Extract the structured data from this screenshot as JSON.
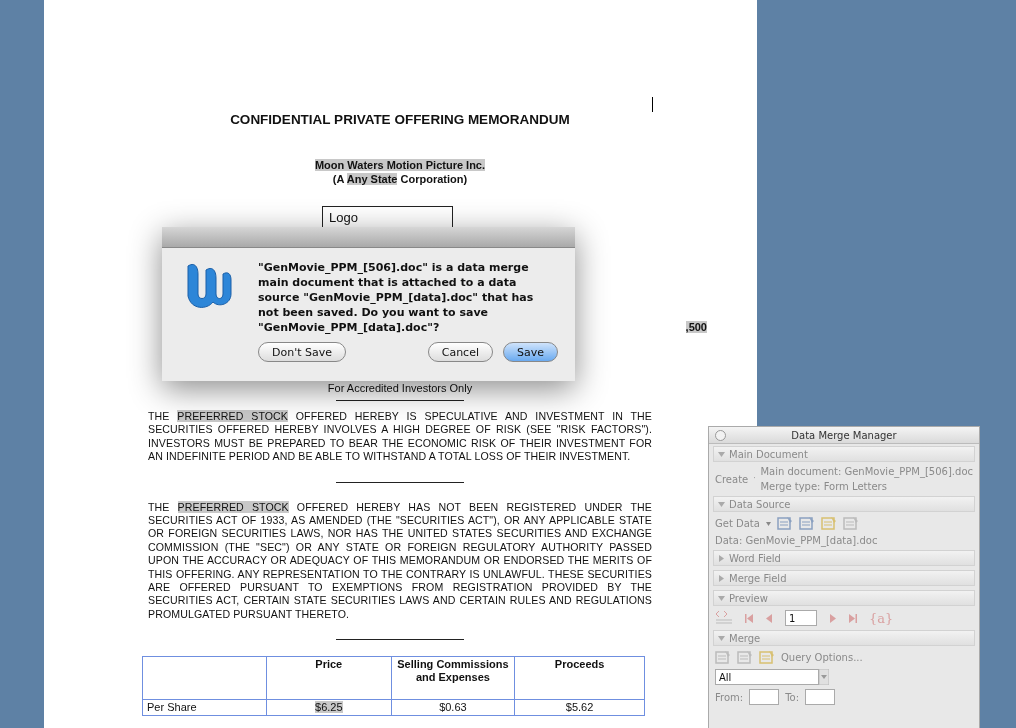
{
  "document": {
    "title": "CONFIDENTIAL PRIVATE OFFERING MEMORANDUM",
    "company": [
      {
        "segments": [
          {
            "text": "Moon Waters Motion Picture Inc.",
            "highlighted": true
          }
        ]
      },
      {
        "segments": [
          {
            "text": "(A ",
            "highlighted": false
          },
          {
            "text": "Any State",
            "highlighted": true
          },
          {
            "text": " Corporation)",
            "highlighted": false
          }
        ]
      }
    ],
    "logo_box": "Logo",
    "amount_fragment": ",500",
    "investors_line": "For Accredited Investors Only",
    "paragraphs": [
      {
        "segments": [
          {
            "text": "THE ",
            "highlighted": false
          },
          {
            "text": "PREFERRED STOCK",
            "highlighted": true
          },
          {
            "text": " OFFERED HEREBY IS SPECULATIVE AND INVESTMENT IN THE SECURITIES OFFERED HEREBY INVOLVES A HIGH DEGREE OF RISK (SEE \"RISK FACTORS\"). INVESTORS MUST BE PREPARED TO BEAR THE ECONOMIC RISK OF THEIR INVESTMENT FOR AN INDEFINITE PERIOD AND BE ABLE TO WITHSTAND A TOTAL LOSS OF THEIR INVESTMENT.",
            "highlighted": false
          }
        ]
      },
      {
        "segments": [
          {
            "text": "THE ",
            "highlighted": false
          },
          {
            "text": "PREFERRED STOCK",
            "highlighted": true
          },
          {
            "text": " OFFERED HEREBY HAS NOT BEEN REGISTERED UNDER THE SECURITIES ACT OF 1933, AS AMENDED (THE \"SECURITIES ACT\"), OR ANY APPLICABLE STATE OR FOREIGN SECURITIES LAWS, NOR HAS THE UNITED STATES SECURITIES AND EXCHANGE COMMISSION (THE \"SEC\") OR ANY STATE OR FOREIGN REGULATORY AUTHORITY PASSED UPON THE ACCURACY OR ADEQUACY OF THIS MEMORANDUM OR ENDORSED THE MERITS OF THIS OFFERING. ANY REPRESENTATION TO THE CONTRARY IS UNLAWFUL. THESE SECURITIES ARE OFFERED PURSUANT TO EXEMPTIONS FROM REGISTRATION PROVIDED BY THE SECURITIES ACT, CERTAIN STATE SECURITIES LAWS AND CERTAIN RULES AND REGULATIONS PROMULGATED PURSUANT THERETO.",
            "highlighted": false
          }
        ]
      }
    ],
    "table": {
      "columns": [
        "",
        "Price",
        "Selling Commissions and Expenses",
        "Proceeds"
      ],
      "rows": [
        {
          "cells": [
            {
              "text": "Per Share",
              "highlighted": false
            },
            {
              "text": "$6.25",
              "highlighted": true
            },
            {
              "text": "$0.63",
              "highlighted": false
            },
            {
              "text": "$5.62",
              "highlighted": false
            }
          ]
        }
      ]
    }
  },
  "dialog": {
    "message": "\"GenMovie_PPM_[506].doc\" is a data merge main document that is attached to a data source \"GenMovie_PPM_[data].doc\" that has not been saved. Do you want to save \"GenMovie_PPM_[data].doc\"?",
    "buttons": [
      {
        "label": "Don't Save",
        "default": false
      },
      {
        "label": "Cancel",
        "default": false
      },
      {
        "label": "Save",
        "default": true
      }
    ]
  },
  "palette": {
    "title": "Data Merge Manager",
    "sections": [
      {
        "kind": "main",
        "label": "Main Document",
        "expanded": true,
        "create": "Create",
        "lines": [
          "Main document: GenMovie_PPM_[506].doc",
          "Merge type: Form Letters"
        ]
      },
      {
        "kind": "source",
        "label": "Data Source",
        "expanded": true,
        "get_data": "Get Data",
        "data": "Data: GenMovie_PPM_[data].doc"
      },
      {
        "label": "Word Field",
        "expanded": false
      },
      {
        "label": "Merge Field",
        "expanded": false
      },
      {
        "kind": "preview",
        "label": "Preview",
        "expanded": true,
        "record": "1",
        "field_codes": "{a}"
      },
      {
        "kind": "merge",
        "label": "Merge",
        "expanded": true,
        "query": "Query Options...",
        "range": "All",
        "from": "From:",
        "to": "To:"
      }
    ]
  }
}
